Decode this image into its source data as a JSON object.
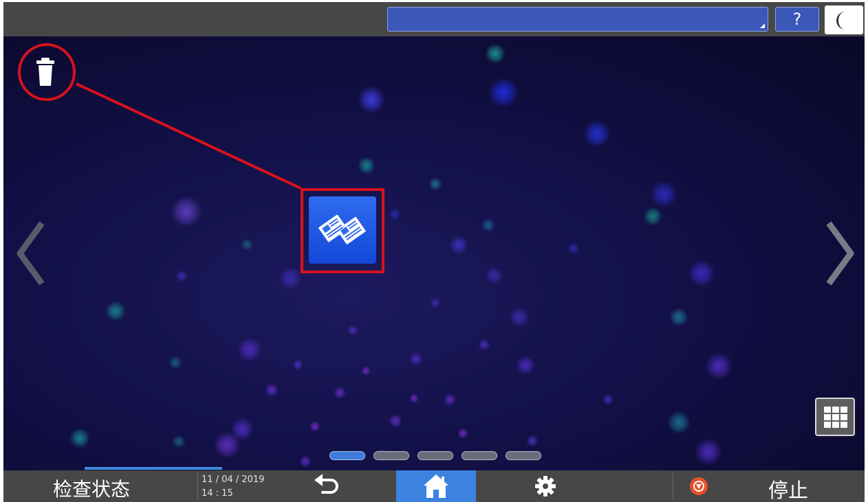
{
  "topbar": {
    "user_field_value": "",
    "help_label": "?",
    "sleep_icon": "moon-icon"
  },
  "main": {
    "trash_icon": "trash-icon",
    "app_icon": "document-server-icon",
    "prev_icon": "chevron-left-icon",
    "next_icon": "chevron-right-icon",
    "apps_icon": "app-grid-icon",
    "pages": {
      "count": 5,
      "active_index": 0
    }
  },
  "bottombar": {
    "status_label": "检查状态",
    "date": "11 / 04 / 2019",
    "time": "14 : 15",
    "back_icon": "back-arrow-icon",
    "home_icon": "home-icon",
    "settings_icon": "gear-icon",
    "stop_icon": "stop-icon",
    "stop_label": "停止"
  },
  "colors": {
    "highlight": "#d8121c",
    "accent": "#3c83e0",
    "bar": "#474747",
    "app_tile": "#1e56e0"
  }
}
